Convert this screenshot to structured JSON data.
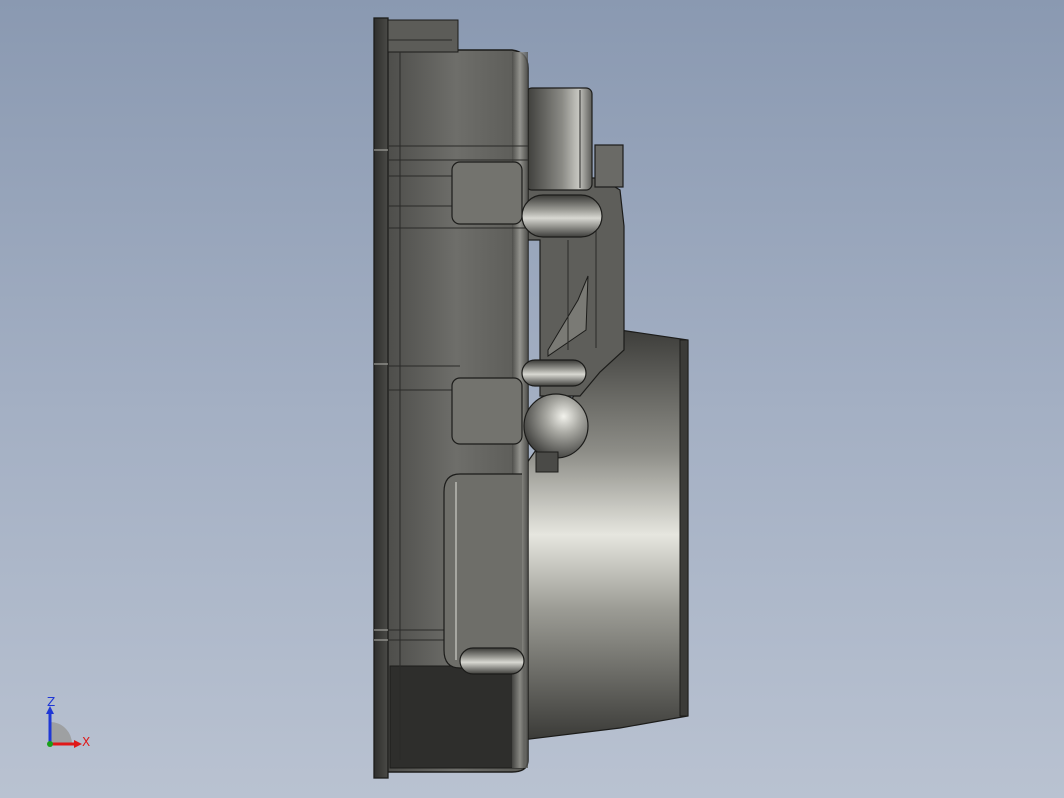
{
  "viewport": {
    "background_top": "#8a99b1",
    "background_bottom": "#b9c2d1"
  },
  "model": {
    "body_color": "#6b6b67",
    "edge_color": "#1c1c1a",
    "highlight_color": "#ededea"
  },
  "triad": {
    "z_label": "Z",
    "x_label": "X",
    "z_color": "#1f37d6",
    "x_color": "#e01818",
    "y_color": "#1aa01a"
  }
}
